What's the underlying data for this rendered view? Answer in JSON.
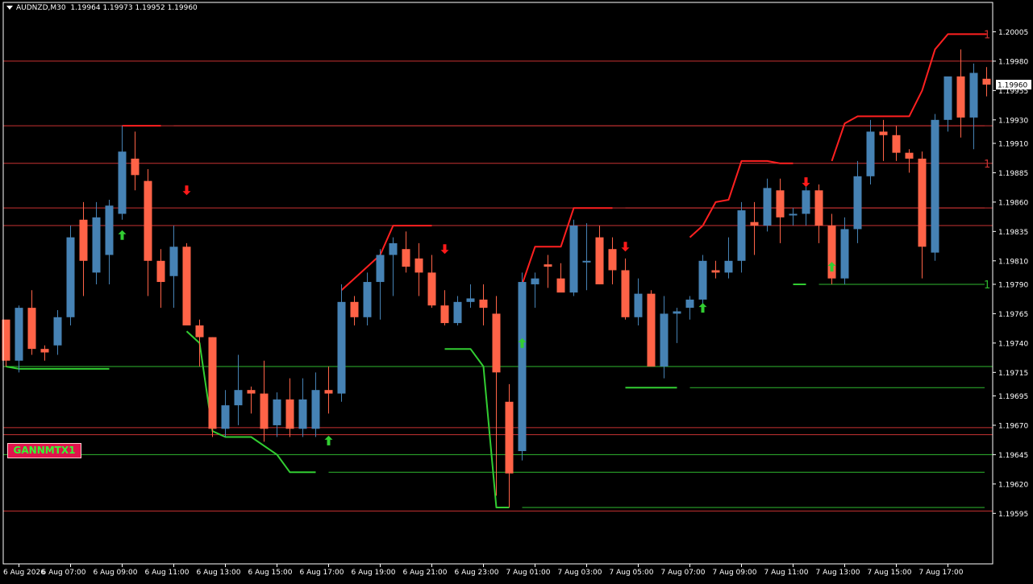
{
  "header": {
    "symbol": "AUDNZD,M30",
    "quote": "1.19964 1.19973 1.19952 1.19960"
  },
  "badge": {
    "label": "GANNMTX1"
  },
  "chart_data": {
    "type": "candlestick",
    "colors": {
      "bull": "#4682b4",
      "bear": "#ff6347",
      "resistance": "#ff2020",
      "support": "#32cd32",
      "grid_red": "#c83232",
      "grid_green": "#2fb82f",
      "axis": "#ffffff"
    },
    "ylim": [
      1.19552,
      1.2003
    ],
    "y_ticks": [
      "1.20005",
      "1.19980",
      "1.19955",
      "1.19930",
      "1.19910",
      "1.19885",
      "1.19860",
      "1.19835",
      "1.19810",
      "1.19790",
      "1.19765",
      "1.19740",
      "1.19715",
      "1.19695",
      "1.19670",
      "1.19645",
      "1.19620",
      "1.19595"
    ],
    "x_ticks": [
      {
        "i": 1,
        "label": "6 Aug 2026"
      },
      {
        "i": 5,
        "label": "6 Aug 07:00"
      },
      {
        "i": 9,
        "label": "6 Aug 09:00"
      },
      {
        "i": 13,
        "label": "6 Aug 11:00"
      },
      {
        "i": 17,
        "label": "6 Aug 13:00"
      },
      {
        "i": 21,
        "label": "6 Aug 15:00"
      },
      {
        "i": 25,
        "label": "6 Aug 17:00"
      },
      {
        "i": 29,
        "label": "6 Aug 19:00"
      },
      {
        "i": 33,
        "label": "6 Aug 21:00"
      },
      {
        "i": 37,
        "label": "6 Aug 23:00"
      },
      {
        "i": 41,
        "label": "7 Aug 01:00"
      },
      {
        "i": 45,
        "label": "7 Aug 03:00"
      },
      {
        "i": 49,
        "label": "7 Aug 05:00"
      },
      {
        "i": 53,
        "label": "7 Aug 07:00"
      },
      {
        "i": 57,
        "label": "7 Aug 09:00"
      },
      {
        "i": 61,
        "label": "7 Aug 11:00"
      },
      {
        "i": 65,
        "label": "7 Aug 13:00"
      },
      {
        "i": 69,
        "label": "7 Aug 15:00"
      },
      {
        "i": 73,
        "label": "7 Aug 17:00"
      }
    ],
    "current_price": "1.19960",
    "candles": [
      [
        1.1976,
        1.1975,
        1.1972,
        1.19725
      ],
      [
        1.19725,
        1.19772,
        1.19715,
        1.1977
      ],
      [
        1.1977,
        1.19785,
        1.1973,
        1.19735
      ],
      [
        1.19735,
        1.19738,
        1.19725,
        1.19732
      ],
      [
        1.19738,
        1.19768,
        1.1973,
        1.19762
      ],
      [
        1.19762,
        1.1984,
        1.19755,
        1.1983
      ],
      [
        1.19845,
        1.1986,
        1.1978,
        1.1981
      ],
      [
        1.198,
        1.1986,
        1.1979,
        1.19847
      ],
      [
        1.19815,
        1.19862,
        1.1979,
        1.19857
      ],
      [
        1.1985,
        1.19925,
        1.19845,
        1.19903
      ],
      [
        1.19897,
        1.1992,
        1.1987,
        1.19883
      ],
      [
        1.19878,
        1.19888,
        1.1978,
        1.1981
      ],
      [
        1.1981,
        1.1982,
        1.1977,
        1.19792
      ],
      [
        1.19797,
        1.1984,
        1.1977,
        1.19822
      ],
      [
        1.19822,
        1.19825,
        1.19757,
        1.19755
      ],
      [
        1.19755,
        1.1976,
        1.1972,
        1.19745
      ],
      [
        1.19745,
        1.19745,
        1.1966,
        1.19667
      ],
      [
        1.19667,
        1.197,
        1.1966,
        1.19687
      ],
      [
        1.19687,
        1.1973,
        1.1967,
        1.197
      ],
      [
        1.197,
        1.19703,
        1.1968,
        1.19697
      ],
      [
        1.19697,
        1.19725,
        1.19656,
        1.19667
      ],
      [
        1.1967,
        1.19698,
        1.1966,
        1.19692
      ],
      [
        1.19692,
        1.1971,
        1.1966,
        1.19667
      ],
      [
        1.19667,
        1.1971,
        1.1966,
        1.19692
      ],
      [
        1.19667,
        1.19715,
        1.1966,
        1.197
      ],
      [
        1.197,
        1.1972,
        1.1968,
        1.19697
      ],
      [
        1.19697,
        1.1979,
        1.1969,
        1.19775
      ],
      [
        1.19775,
        1.1978,
        1.19755,
        1.19762
      ],
      [
        1.19762,
        1.198,
        1.19755,
        1.19792
      ],
      [
        1.19792,
        1.1982,
        1.1976,
        1.19815
      ],
      [
        1.19815,
        1.1983,
        1.1978,
        1.19825
      ],
      [
        1.1982,
        1.19835,
        1.198,
        1.19805
      ],
      [
        1.19812,
        1.19825,
        1.1978,
        1.198
      ],
      [
        1.198,
        1.19815,
        1.1977,
        1.19772
      ],
      [
        1.19772,
        1.19785,
        1.19755,
        1.19757
      ],
      [
        1.19757,
        1.1978,
        1.19755,
        1.19775
      ],
      [
        1.19775,
        1.1979,
        1.1977,
        1.19778
      ],
      [
        1.19777,
        1.1979,
        1.19755,
        1.1977
      ],
      [
        1.19765,
        1.1978,
        1.1961,
        1.19715
      ],
      [
        1.1969,
        1.19705,
        1.196,
        1.19629
      ],
      [
        1.19648,
        1.198,
        1.1964,
        1.19792
      ],
      [
        1.1979,
        1.198,
        1.1977,
        1.19795
      ],
      [
        1.19807,
        1.19815,
        1.19787,
        1.19805
      ],
      [
        1.19795,
        1.19808,
        1.19785,
        1.19783
      ],
      [
        1.19783,
        1.19845,
        1.1978,
        1.1984
      ],
      [
        1.1981,
        1.19842,
        1.19785,
        1.1981
      ],
      [
        1.1983,
        1.1984,
        1.1979,
        1.1979
      ],
      [
        1.1982,
        1.1983,
        1.1979,
        1.19802
      ],
      [
        1.19802,
        1.19812,
        1.1976,
        1.19762
      ],
      [
        1.19762,
        1.19795,
        1.19755,
        1.19782
      ],
      [
        1.19782,
        1.19785,
        1.1972,
        1.1972
      ],
      [
        1.1972,
        1.1978,
        1.1971,
        1.19765
      ],
      [
        1.19765,
        1.1977,
        1.1974,
        1.19767
      ],
      [
        1.1977,
        1.1978,
        1.1976,
        1.19777
      ],
      [
        1.19777,
        1.19815,
        1.1977,
        1.1981
      ],
      [
        1.19802,
        1.1981,
        1.19795,
        1.198
      ],
      [
        1.198,
        1.1983,
        1.19795,
        1.1981
      ],
      [
        1.1981,
        1.1986,
        1.198,
        1.19853
      ],
      [
        1.19843,
        1.1986,
        1.19815,
        1.1984
      ],
      [
        1.1984,
        1.1988,
        1.19835,
        1.19872
      ],
      [
        1.1987,
        1.1988,
        1.19825,
        1.19847
      ],
      [
        1.1985,
        1.19855,
        1.1984,
        1.1985
      ],
      [
        1.1985,
        1.19875,
        1.1984,
        1.1987
      ],
      [
        1.1987,
        1.19875,
        1.19825,
        1.1984
      ],
      [
        1.1984,
        1.1985,
        1.1979,
        1.19795
      ],
      [
        1.19795,
        1.19847,
        1.1979,
        1.19837
      ],
      [
        1.19837,
        1.19895,
        1.19825,
        1.19882
      ],
      [
        1.19882,
        1.1993,
        1.19875,
        1.1992
      ],
      [
        1.1992,
        1.1993,
        1.19895,
        1.19917
      ],
      [
        1.19917,
        1.19925,
        1.19895,
        1.19902
      ],
      [
        1.19902,
        1.19905,
        1.19885,
        1.19897
      ],
      [
        1.19897,
        1.19903,
        1.19795,
        1.19822
      ],
      [
        1.19817,
        1.19935,
        1.1981,
        1.1993
      ],
      [
        1.1993,
        1.19965,
        1.1992,
        1.19967
      ],
      [
        1.19967,
        1.1999,
        1.19915,
        1.19932
      ],
      [
        1.19932,
        1.19978,
        1.19905,
        1.1997
      ],
      [
        1.19965,
        1.19975,
        1.1995,
        1.1996
      ]
    ],
    "resistance_path": [
      [
        9,
        1.19925
      ],
      [
        12,
        1.19925
      ],
      [
        null,
        null
      ],
      [
        26,
        1.19785
      ],
      [
        27,
        1.19795
      ],
      [
        28,
        1.19805
      ],
      [
        29,
        1.19815
      ],
      [
        30,
        1.1984
      ],
      [
        33,
        1.1984
      ],
      [
        null,
        null
      ],
      [
        40,
        1.1979
      ],
      [
        41,
        1.19822
      ],
      [
        43,
        1.19822
      ],
      [
        44,
        1.19855
      ],
      [
        47,
        1.19855
      ],
      [
        null,
        null
      ],
      [
        53,
        1.1983
      ],
      [
        54,
        1.1984
      ],
      [
        55,
        1.1986
      ],
      [
        56,
        1.19862
      ],
      [
        57,
        1.19895
      ],
      [
        59,
        1.19895
      ],
      [
        60,
        1.19893
      ],
      [
        61,
        1.19893
      ],
      [
        null,
        null
      ],
      [
        64,
        1.19895
      ],
      [
        65,
        1.19927
      ],
      [
        66,
        1.19933
      ],
      [
        70,
        1.19933
      ],
      [
        71,
        1.19955
      ],
      [
        72,
        1.1999
      ],
      [
        73,
        1.20003
      ],
      [
        76,
        1.20003
      ]
    ],
    "support_path": [
      [
        0,
        1.1972
      ],
      [
        1,
        1.19718
      ],
      [
        8,
        1.19718
      ],
      [
        null,
        null
      ],
      [
        14,
        1.1975
      ],
      [
        15,
        1.1974
      ],
      [
        16,
        1.19665
      ],
      [
        17,
        1.1966
      ],
      [
        19,
        1.1966
      ],
      [
        21,
        1.19645
      ],
      [
        22,
        1.1963
      ],
      [
        24,
        1.1963
      ],
      [
        null,
        null
      ],
      [
        34,
        1.19735
      ],
      [
        36,
        1.19735
      ],
      [
        37,
        1.1972
      ],
      [
        38,
        1.196
      ],
      [
        39,
        1.196
      ],
      [
        null,
        null
      ],
      [
        48,
        1.19702
      ],
      [
        52,
        1.19702
      ],
      [
        null,
        null
      ],
      [
        61,
        1.1979
      ],
      [
        62,
        1.1979
      ]
    ],
    "h_levels_full": [
      {
        "price": 1.1998,
        "color": "red"
      },
      {
        "price": 1.19925,
        "color": "red"
      },
      {
        "price": 1.19893,
        "color": "red"
      },
      {
        "price": 1.19855,
        "color": "red"
      },
      {
        "price": 1.1984,
        "color": "red"
      },
      {
        "price": 1.1972,
        "color": "green"
      },
      {
        "price": 1.19668,
        "color": "red"
      },
      {
        "price": 1.19662,
        "color": "red"
      },
      {
        "price": 1.19645,
        "color": "green"
      },
      {
        "price": 1.19597,
        "color": "red"
      }
    ],
    "h_levels_partial": [
      {
        "from": 13,
        "price": 1.19925,
        "color": "red"
      },
      {
        "from": 34,
        "price": 1.1984,
        "color": "red"
      },
      {
        "from": 48,
        "price": 1.19855,
        "color": "red"
      },
      {
        "from": 53,
        "price": 1.19702,
        "color": "green"
      },
      {
        "from": 25,
        "price": 1.1963,
        "color": "green"
      },
      {
        "from": 40,
        "price": 1.196,
        "color": "green"
      },
      {
        "from": 63,
        "price": 1.1979,
        "color": "green"
      }
    ],
    "right_labels": [
      {
        "price": 1.20003,
        "text": "1",
        "color": "red"
      },
      {
        "price": 1.19893,
        "text": "1",
        "color": "red"
      },
      {
        "price": 1.1979,
        "text": "1",
        "color": "green"
      }
    ],
    "arrows": [
      {
        "i": 9,
        "price": 1.19832,
        "dir": "up"
      },
      {
        "i": 14,
        "price": 1.1987,
        "dir": "down"
      },
      {
        "i": 25,
        "price": 1.19657,
        "dir": "up"
      },
      {
        "i": 34,
        "price": 1.1982,
        "dir": "down"
      },
      {
        "i": 40,
        "price": 1.1974,
        "dir": "up"
      },
      {
        "i": 48,
        "price": 1.19822,
        "dir": "down"
      },
      {
        "i": 54,
        "price": 1.1977,
        "dir": "up"
      },
      {
        "i": 62,
        "price": 1.19877,
        "dir": "down"
      },
      {
        "i": 64,
        "price": 1.19805,
        "dir": "up"
      }
    ]
  }
}
